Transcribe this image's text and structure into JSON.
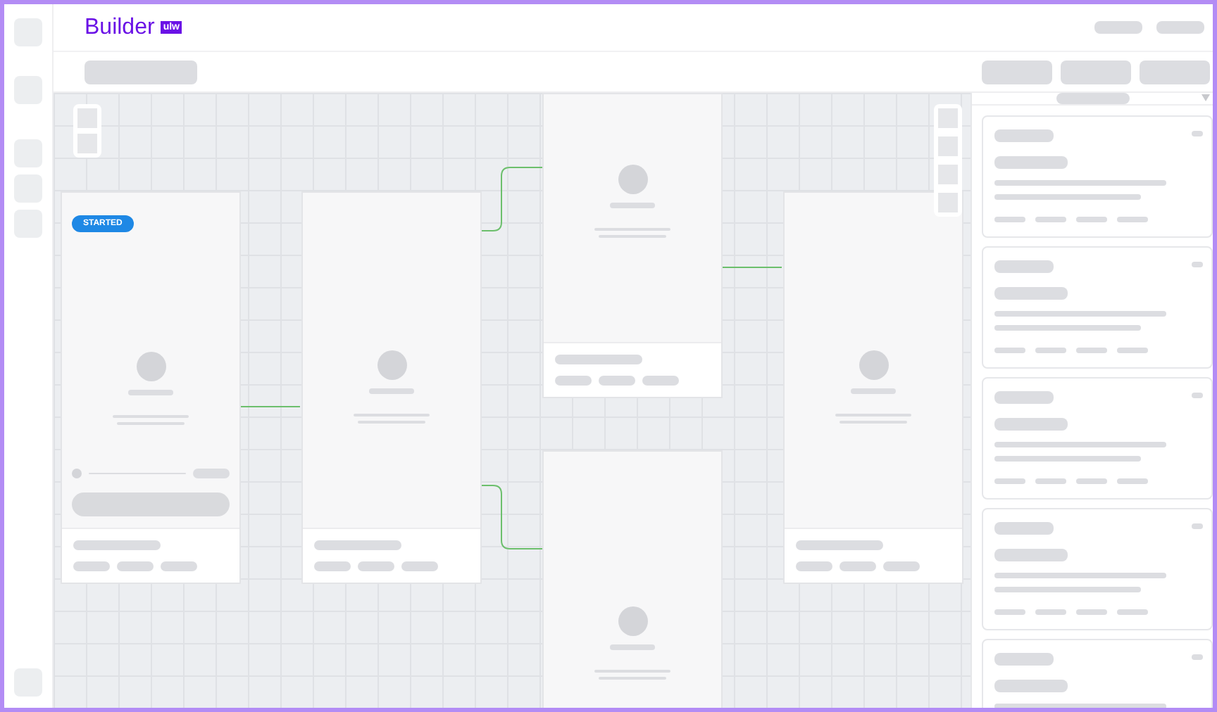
{
  "header": {
    "logo": "Builder",
    "badge": "ulw"
  },
  "canvas": {
    "nodes": [
      {
        "kind": "start",
        "badge": "STARTED"
      },
      {
        "kind": "screen"
      },
      {
        "kind": "screen-top"
      },
      {
        "kind": "screen-bottom"
      },
      {
        "kind": "screen"
      }
    ]
  }
}
